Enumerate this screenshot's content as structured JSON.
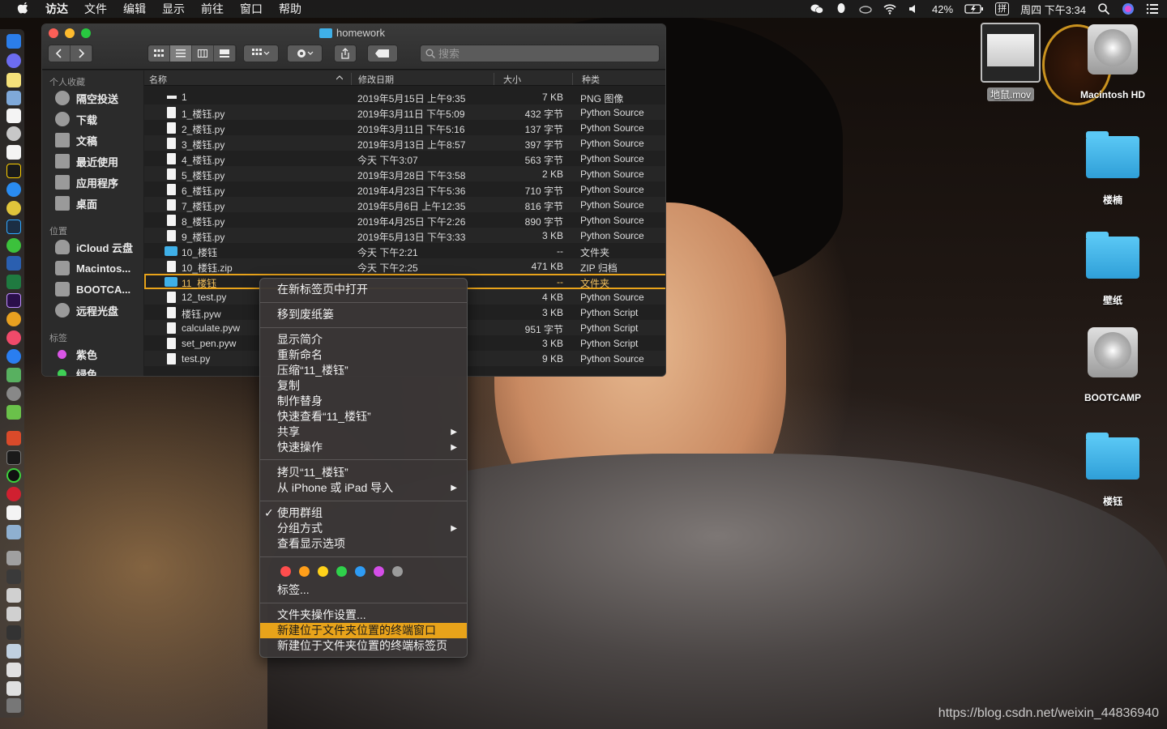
{
  "menubar": {
    "items": [
      "访达",
      "文件",
      "编辑",
      "显示",
      "前往",
      "窗口",
      "帮助"
    ],
    "battery": "42%",
    "input_method": "拼",
    "clock": "周四 下午3:34"
  },
  "finder": {
    "title": "homework",
    "search_placeholder": "搜索",
    "sidebar": {
      "favorites_header": "个人收藏",
      "favorites": [
        "隔空投送",
        "下载",
        "文稿",
        "最近使用",
        "应用程序",
        "桌面"
      ],
      "locations_header": "位置",
      "locations": [
        "iCloud 云盘",
        "Macintos...",
        "BOOTCA...",
        "远程光盘"
      ],
      "tags_header": "标签",
      "tags": [
        {
          "label": "紫色",
          "color": "#d955e6"
        },
        {
          "label": "绿色",
          "color": "#3fcf55"
        }
      ]
    },
    "columns": {
      "name": "名称",
      "date": "修改日期",
      "size": "大小",
      "kind": "种类"
    },
    "rows": [
      {
        "icon": "img",
        "name": "1",
        "date": "2019年5月15日 上午9:35",
        "size": "7 KB",
        "kind": "PNG 图像"
      },
      {
        "icon": "doc",
        "name": "1_楼钰.py",
        "date": "2019年3月11日 下午5:09",
        "size": "432 字节",
        "kind": "Python Source"
      },
      {
        "icon": "doc",
        "name": "2_楼钰.py",
        "date": "2019年3月11日 下午5:16",
        "size": "137 字节",
        "kind": "Python Source"
      },
      {
        "icon": "doc",
        "name": "3_楼钰.py",
        "date": "2019年3月13日 上午8:57",
        "size": "397 字节",
        "kind": "Python Source"
      },
      {
        "icon": "doc",
        "name": "4_楼钰.py",
        "date": "今天 下午3:07",
        "size": "563 字节",
        "kind": "Python Source"
      },
      {
        "icon": "doc",
        "name": "5_楼钰.py",
        "date": "2019年3月28日 下午3:58",
        "size": "2 KB",
        "kind": "Python Source"
      },
      {
        "icon": "doc",
        "name": "6_楼钰.py",
        "date": "2019年4月23日 下午5:36",
        "size": "710 字节",
        "kind": "Python Source"
      },
      {
        "icon": "doc",
        "name": "7_楼钰.py",
        "date": "2019年5月6日 上午12:35",
        "size": "816 字节",
        "kind": "Python Source"
      },
      {
        "icon": "doc",
        "name": "8_楼钰.py",
        "date": "2019年4月25日 下午2:26",
        "size": "890 字节",
        "kind": "Python Source"
      },
      {
        "icon": "doc",
        "name": "9_楼钰.py",
        "date": "2019年5月13日 下午3:33",
        "size": "3 KB",
        "kind": "Python Source"
      },
      {
        "icon": "folder",
        "name": "10_楼钰",
        "date": "今天 下午2:21",
        "size": "--",
        "kind": "文件夹"
      },
      {
        "icon": "doc",
        "name": "10_楼钰.zip",
        "date": "今天 下午2:25",
        "size": "471 KB",
        "kind": "ZIP 归档"
      },
      {
        "icon": "folder",
        "name": "11_楼钰",
        "date": "",
        "size": "--",
        "kind": "文件夹",
        "selected": true
      },
      {
        "icon": "doc",
        "name": "12_test.py",
        "date": "",
        "size": "4 KB",
        "kind": "Python Source"
      },
      {
        "icon": "doc",
        "name": "楼钰.pyw",
        "date": "",
        "size": "3 KB",
        "kind": "Python Script"
      },
      {
        "icon": "doc",
        "name": "calculate.pyw",
        "date": "",
        "size": "951 字节",
        "kind": "Python Script"
      },
      {
        "icon": "doc",
        "name": "set_pen.pyw",
        "date": "",
        "size": "3 KB",
        "kind": "Python Script"
      },
      {
        "icon": "doc",
        "name": "test.py",
        "date": "",
        "size": "9 KB",
        "kind": "Python Source"
      }
    ]
  },
  "context_menu": {
    "open_in_tab": "在新标签页中打开",
    "trash": "移到废纸篓",
    "get_info": "显示简介",
    "rename": "重新命名",
    "compress": "压缩“11_楼钰”",
    "duplicate": "复制",
    "alias": "制作替身",
    "quicklook": "快速查看“11_楼钰”",
    "share": "共享",
    "quick_actions": "快速操作",
    "copy": "拷贝“11_楼钰”",
    "import": "从 iPhone 或 iPad 导入",
    "use_groups": "使用群组",
    "group_by": "分组方式",
    "view_options": "查看显示选项",
    "tag_colors": [
      "#ff4d4d",
      "#ff9f1a",
      "#ffd21a",
      "#2fd14b",
      "#2e9cf5",
      "#d44ee8",
      "#9b9b9b"
    ],
    "tags": "标签...",
    "folder_actions": "文件夹操作设置...",
    "new_terminal": "新建位于文件夹位置的终端窗口",
    "new_terminal_tab": "新建位于文件夹位置的终端标签页"
  },
  "desktop": {
    "movie": "地鼠.mov",
    "macintosh_hd": "Macintosh HD",
    "folder1": "楼楠",
    "folder2": "壁纸",
    "bootcamp": "BOOTCAMP",
    "folder3": "楼钰"
  },
  "watermark": "https://blog.csdn.net/weixin_44836940"
}
